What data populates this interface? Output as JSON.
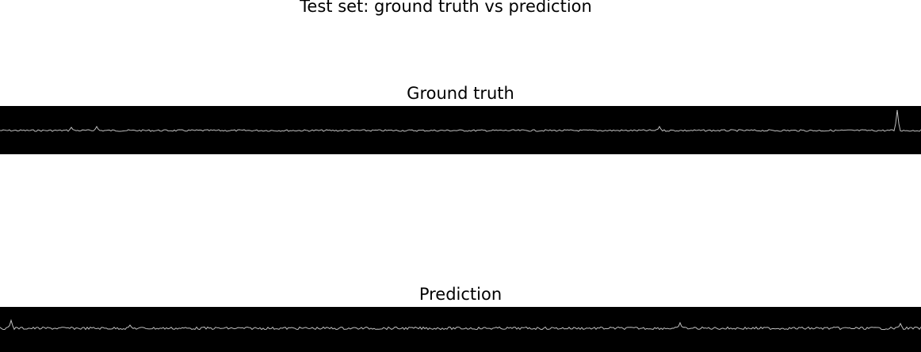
{
  "figure": {
    "title": "Test set: ground truth vs prediction"
  },
  "panels": [
    {
      "title": "Ground truth",
      "colormap": "grayscale"
    },
    {
      "title": "Prediction",
      "colormap": "grayscale"
    }
  ],
  "colors": {
    "background": "#ffffff",
    "image_background": "#000000",
    "trace": "#bfbfbf"
  }
}
